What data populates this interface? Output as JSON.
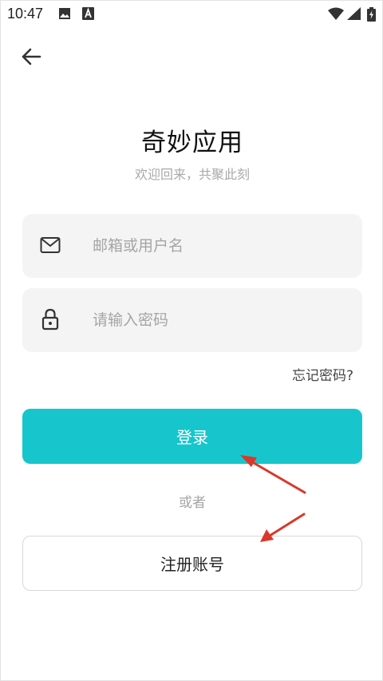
{
  "status_bar": {
    "time": "10:47",
    "left_icons": [
      "image-icon",
      "a-icon"
    ],
    "right_icons": [
      "wifi-icon",
      "signal-icon",
      "battery-icon"
    ]
  },
  "nav": {
    "back_icon": "arrow-left-icon"
  },
  "header": {
    "title": "奇妙应用",
    "subtitle": "欢迎回来，共聚此刻"
  },
  "form": {
    "username": {
      "placeholder": "邮箱或用户名",
      "value": "",
      "icon": "mail-icon"
    },
    "password": {
      "placeholder": "请输入密码",
      "value": "",
      "icon": "lock-icon"
    },
    "forgot_label": "忘记密码?",
    "login_label": "登录",
    "or_label": "或者",
    "register_label": "注册账号"
  },
  "colors": {
    "accent": "#16c6cc",
    "input_bg": "#f4f4f4",
    "annotation_arrow": "#d9382a"
  }
}
